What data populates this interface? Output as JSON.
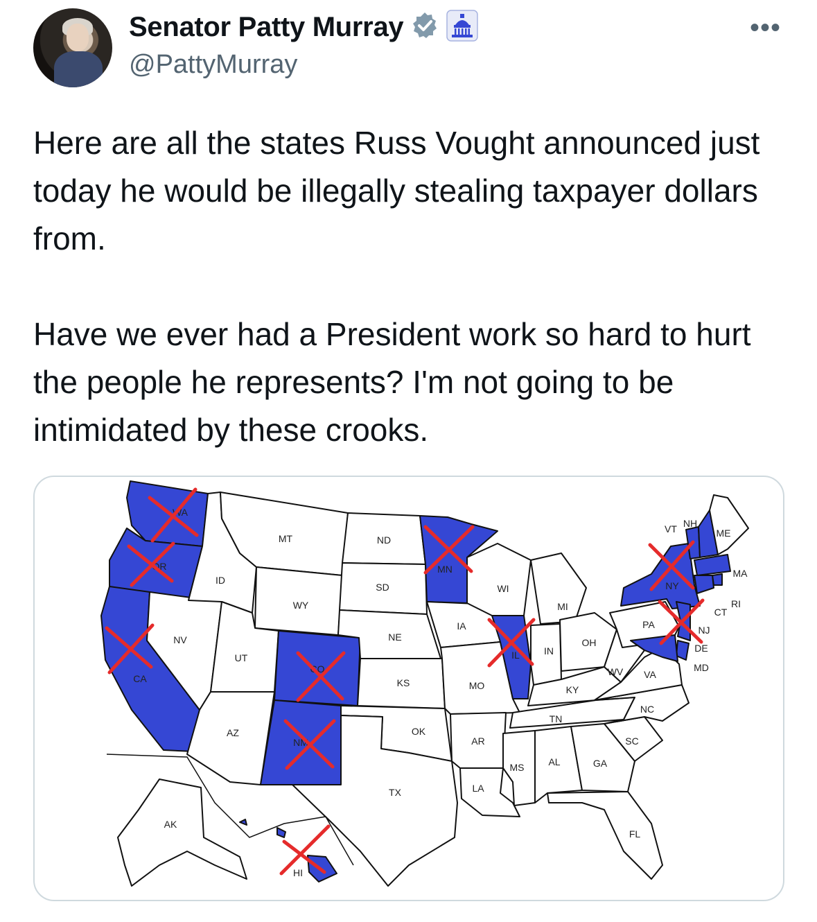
{
  "author": {
    "name": "Senator Patty Murray",
    "handle": "@PattyMurray",
    "verified_icon": "verified-badge-icon",
    "affiliation_icon": "capitol-building-icon"
  },
  "menu_glyph": "•••",
  "tweet": {
    "paragraph1": "Here are all the states Russ Vought announced just today he would be illegally stealing taxpayer dollars from.",
    "paragraph2": "Have we ever had a President work so hard to hurt the people he represents? I'm not going to be intimidated by these crooks."
  },
  "map": {
    "highlight_color": "#3547d4",
    "cross_color": "#e52b2b",
    "state_labels": [
      "WA",
      "OR",
      "CA",
      "NV",
      "ID",
      "MT",
      "WY",
      "UT",
      "AZ",
      "CO",
      "NM",
      "ND",
      "SD",
      "NE",
      "KS",
      "OK",
      "TX",
      "MN",
      "IA",
      "MO",
      "AR",
      "LA",
      "WI",
      "IL",
      "MI",
      "IN",
      "OH",
      "KY",
      "TN",
      "MS",
      "AL",
      "GA",
      "FL",
      "SC",
      "NC",
      "VA",
      "WV",
      "PA",
      "NY",
      "VT",
      "NH",
      "ME",
      "MA",
      "RI",
      "CT",
      "NJ",
      "DE",
      "MD",
      "AK",
      "HI"
    ],
    "highlighted_states": [
      "WA",
      "OR",
      "CA",
      "CO",
      "NM",
      "MN",
      "IL",
      "NY",
      "VT",
      "NH",
      "MA",
      "RI",
      "CT",
      "NJ",
      "DE",
      "MD",
      "HI"
    ],
    "crossed_states": [
      "WA",
      "OR",
      "CA",
      "CO",
      "NM",
      "MN",
      "IL",
      "NY",
      "NJ",
      "HI"
    ]
  }
}
